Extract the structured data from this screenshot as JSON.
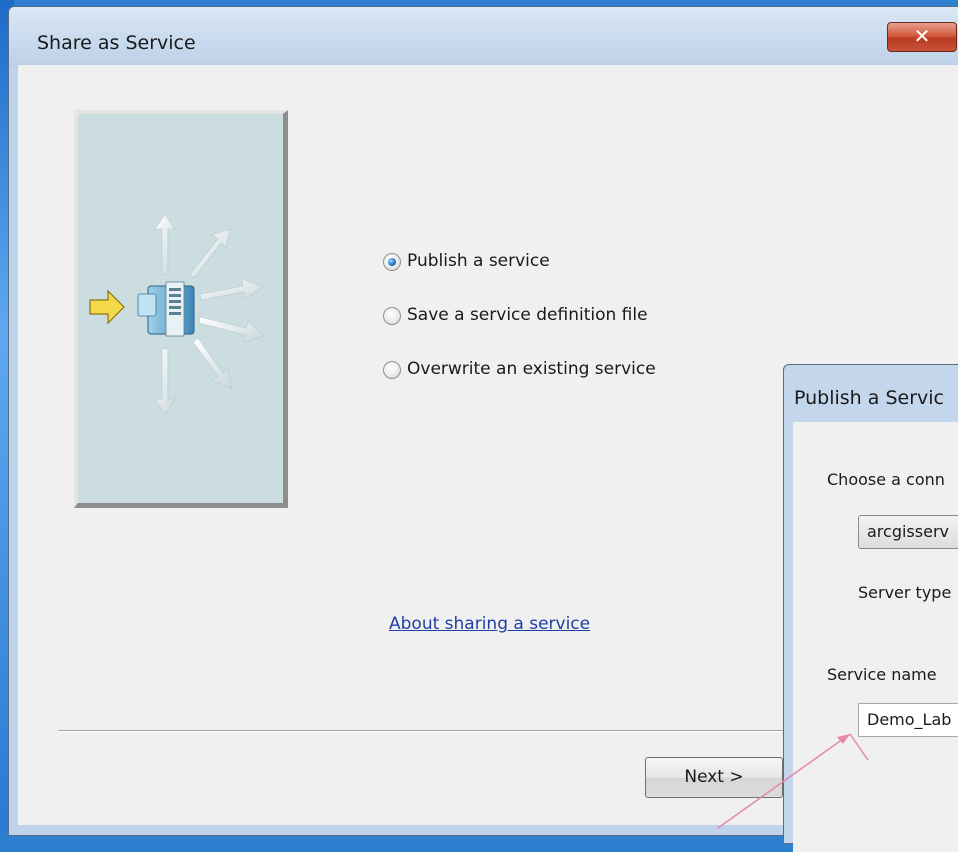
{
  "dialog": {
    "title": "Share as Service",
    "close_glyph": "✕"
  },
  "options": [
    {
      "label": "Publish a service",
      "checked": true
    },
    {
      "label": "Save a service definition file",
      "checked": false
    },
    {
      "label": "Overwrite an existing service",
      "checked": false
    }
  ],
  "about_link": "About sharing a service",
  "next_button": "Next >",
  "publish_dialog": {
    "title": "Publish a Servic",
    "choose_connection_label": "Choose a conn",
    "connection_value": "arcgisserv",
    "server_type_label": "Server type",
    "service_name_label": "Service name",
    "service_name_value": "Demo_Lab"
  },
  "colors": {
    "accent_radio": "#2a78c8",
    "link": "#1f3fa6",
    "close": "#c8533a",
    "annotation_arrow": "#e48aa4"
  },
  "icons": [
    "arrow-right-icon",
    "server-icon",
    "close-icon"
  ]
}
